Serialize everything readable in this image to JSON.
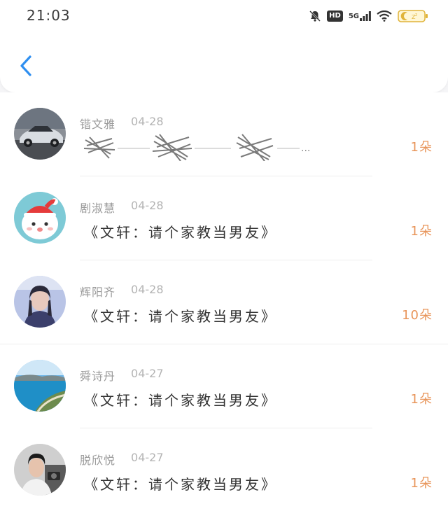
{
  "status_bar": {
    "time": "21:03",
    "hd_label": "HD",
    "network_label": "5G"
  },
  "header": {
    "back_icon": "chevron-left-icon"
  },
  "colors": {
    "accent_blue": "#2f8ff0",
    "flower_orange": "#e8955a",
    "name_gray": "#9a9a9a",
    "text_dark": "#333333"
  },
  "items": [
    {
      "name": "锴文雅",
      "date": "04-28",
      "message": "",
      "message_partial": "...",
      "flowers": "1朵"
    },
    {
      "name": "剧淑慧",
      "date": "04-28",
      "message": "《文轩：请个家教当男友》",
      "flowers": "1朵"
    },
    {
      "name": "辉阳齐",
      "date": "04-28",
      "message": "《文轩：请个家教当男友》",
      "flowers": "10朵"
    },
    {
      "name": "舜诗丹",
      "date": "04-27",
      "message": "《文轩：请个家教当男友》",
      "flowers": "1朵"
    },
    {
      "name": "脱欣悦",
      "date": "04-27",
      "message": "《文轩：请个家教当男友》",
      "flowers": "1朵"
    }
  ]
}
